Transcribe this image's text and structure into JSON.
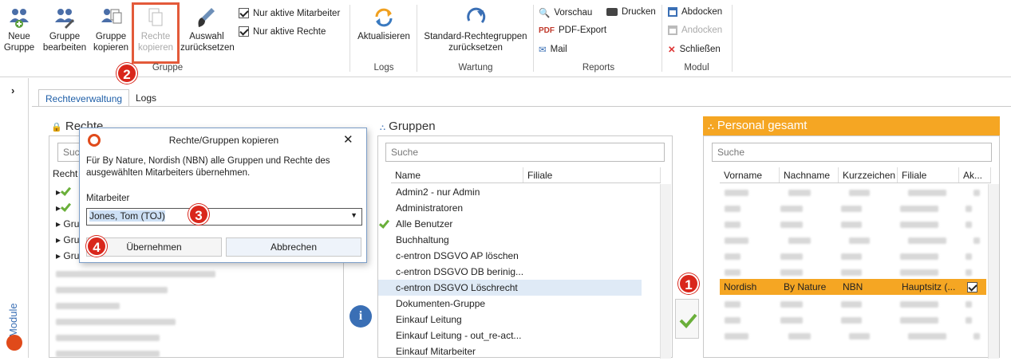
{
  "ribbon": {
    "buttons": [
      {
        "label": "Neue\nGruppe",
        "icon": "new-group-icon"
      },
      {
        "label": "Gruppe\nbearbeiten",
        "icon": "edit-group-icon"
      },
      {
        "label": "Gruppe\nkopieren",
        "icon": "copy-group-icon"
      },
      {
        "label": "Rechte\nkopieren",
        "icon": "copy-rights-icon"
      },
      {
        "label": "Auswahl\nzurücksetzen",
        "icon": "brush-icon"
      },
      {
        "label": "Aktualisieren",
        "icon": "refresh-icon"
      },
      {
        "label": "Standard-Rechtegruppen\nzurücksetzen",
        "icon": "reset-icon"
      }
    ],
    "checkboxes": [
      {
        "label": "Nur aktive Mitarbeiter",
        "checked": true
      },
      {
        "label": "Nur aktive Rechte",
        "checked": true
      }
    ],
    "reports": [
      {
        "label": "Vorschau",
        "icon": "preview-icon"
      },
      {
        "label": "PDF-Export",
        "icon": "pdf-icon"
      },
      {
        "label": "Mail",
        "icon": "mail-icon"
      },
      {
        "label": "Drucken",
        "icon": "printer-icon"
      }
    ],
    "module": [
      {
        "label": "Abdocken",
        "icon": "undock-icon"
      },
      {
        "label": "Andocken",
        "icon": "dock-icon"
      },
      {
        "label": "Schließen",
        "icon": "close-icon"
      }
    ],
    "groups": [
      "Gruppe",
      "Logs",
      "Wartung",
      "Reports",
      "Modul"
    ]
  },
  "callouts": [
    "1",
    "2",
    "3",
    "4"
  ],
  "side_label": "Module",
  "tabs": [
    "Rechteverwaltung",
    "Logs"
  ],
  "rights_panel": {
    "title": "Rechte",
    "search": "Suche",
    "col": "Recht",
    "rows": [
      "Gru",
      "Gru",
      "Gru"
    ]
  },
  "groups_panel": {
    "title": "Gruppen",
    "search": "Suche",
    "cols": [
      "Name",
      "Filiale"
    ],
    "rows": [
      "Admin2 - nur Admin",
      "Administratoren",
      "Alle Benutzer",
      "Buchhaltung",
      "c-entron DSGVO AP löschen",
      "c-entron DSGVO DB berinig...",
      "c-entron DSGVO Löschrecht",
      "Dokumenten-Gruppe",
      "Einkauf Leitung",
      "Einkauf Leitung - out_re-act...",
      "Einkauf Mitarbeiter"
    ]
  },
  "personal_panel": {
    "title": "Personal gesamt",
    "search": "Suche",
    "cols": [
      "Vorname",
      "Nachname",
      "Kurzzeichen",
      "Filiale",
      "Ak..."
    ],
    "selected": {
      "vorname": "Nordish",
      "nachname": "By Nature",
      "kurz": "NBN",
      "filiale": "Hauptsitz (..."
    }
  },
  "dialog": {
    "title": "Rechte/Gruppen kopieren",
    "text": "Für  By Nature, Nordish (NBN)  alle Gruppen und Rechte des ausgewählten Mitarbeiters übernehmen.",
    "field_label": "Mitarbeiter",
    "field_value": "Jones, Tom (TOJ)",
    "ok": "Übernehmen",
    "cancel": "Abbrechen"
  },
  "colors": {
    "accent": "#f5a623",
    "callout": "#d9271c",
    "tab": "#1f5fa8"
  }
}
